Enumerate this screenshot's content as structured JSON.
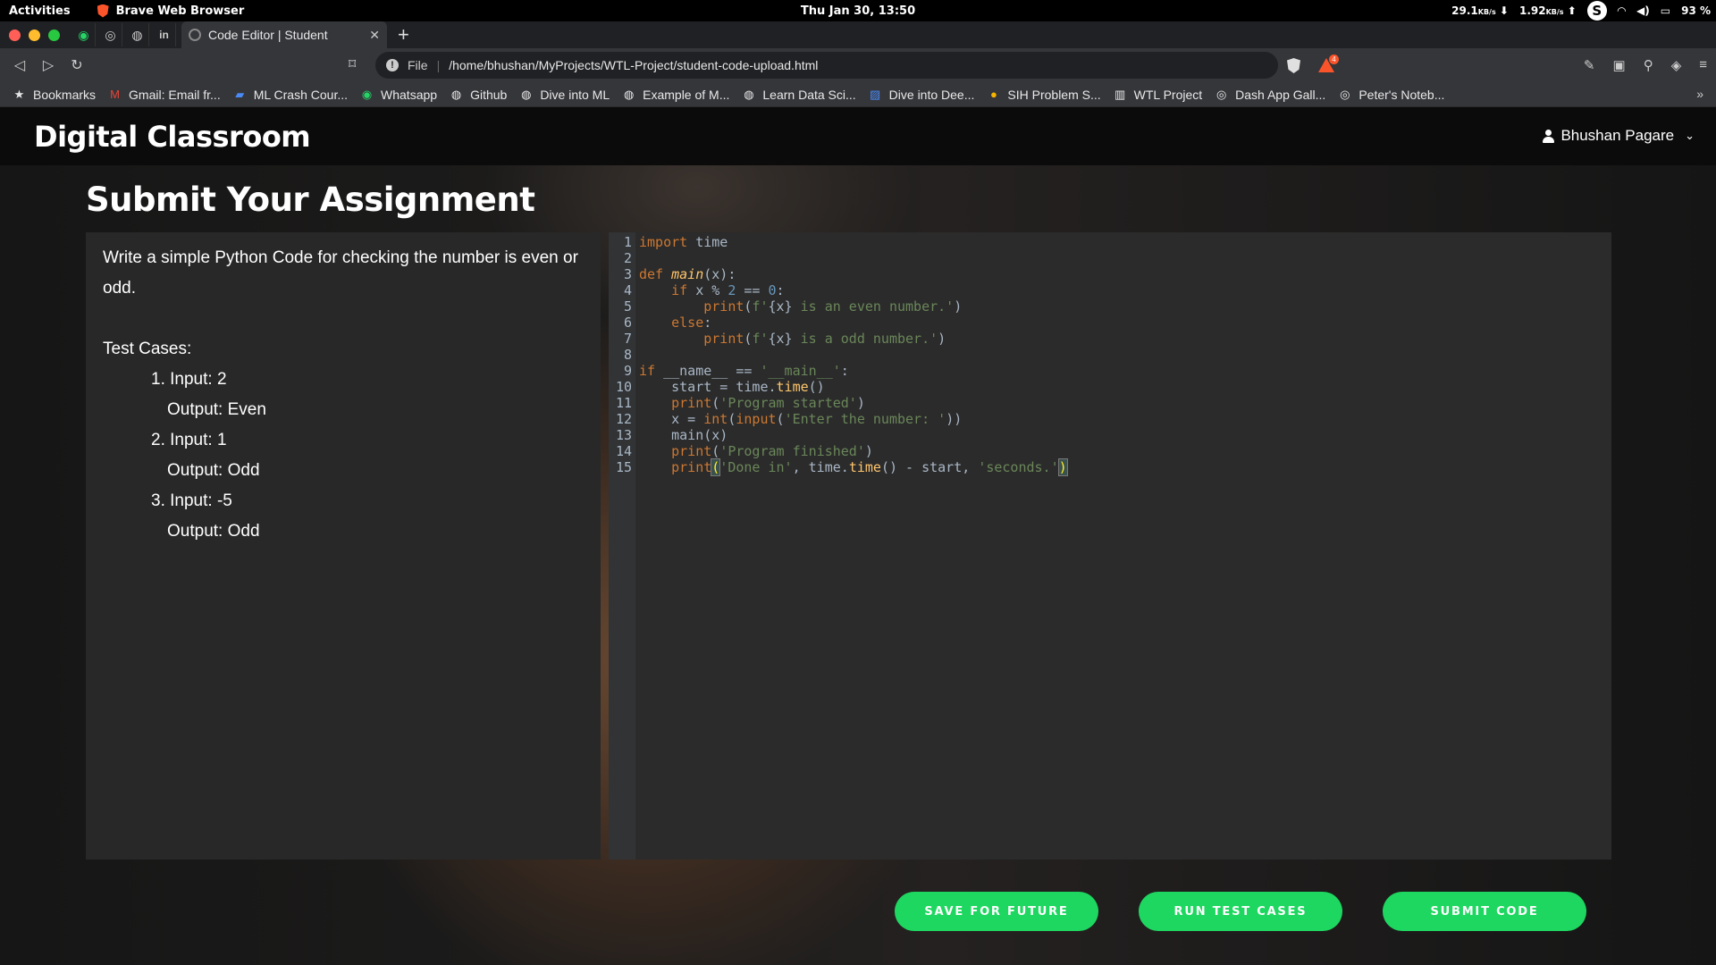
{
  "os": {
    "activities": "Activities",
    "app_name": "Brave Web Browser",
    "clock": "Thu Jan 30, 13:50",
    "down_rate": "29.1",
    "down_unit": "KB/s",
    "up_rate": "1.92",
    "up_unit": "KB/s",
    "skype_letter": "S",
    "battery": "93 %"
  },
  "browser": {
    "tab_title": "Code Editor | Student",
    "url_scheme": "File",
    "url_path": "/home/bhushan/MyProjects/WTL-Project/student-code-upload.html",
    "alert_count": "4",
    "bookmarks": [
      {
        "label": "Bookmarks",
        "icon": "star-icon"
      },
      {
        "label": "Gmail: Email fr...",
        "icon": "gmail-icon"
      },
      {
        "label": "ML Crash Cour...",
        "icon": "ml-icon"
      },
      {
        "label": "Whatsapp",
        "icon": "whatsapp-icon"
      },
      {
        "label": "Github",
        "icon": "github-icon"
      },
      {
        "label": "Dive into ML",
        "icon": "github-icon"
      },
      {
        "label": "Example of M...",
        "icon": "github-icon"
      },
      {
        "label": "Learn Data Sci...",
        "icon": "github-icon"
      },
      {
        "label": "Dive into Dee...",
        "icon": "book-icon"
      },
      {
        "label": "SIH Problem S...",
        "icon": "bulb-icon"
      },
      {
        "label": "WTL Project",
        "icon": "trello-icon"
      },
      {
        "label": "Dash App Gall...",
        "icon": "globe-icon"
      },
      {
        "label": "Peter's Noteb...",
        "icon": "globe-icon"
      }
    ]
  },
  "app": {
    "brand": "Digital Classroom",
    "user_name": "Bhushan Pagare",
    "heading": "Submit Your Assignment",
    "question_text": "Write a simple Python Code for checking the number is even or odd.",
    "test_cases_label": "Test Cases:",
    "test_cases": [
      {
        "input": "1. Input: 2",
        "output": "Output: Even"
      },
      {
        "input": "2. Input: 1",
        "output": "Output: Odd"
      },
      {
        "input": "3. Input: -5",
        "output": "Output: Odd"
      }
    ],
    "line_numbers": [
      "1",
      "2",
      "3",
      "4",
      "5",
      "6",
      "7",
      "8",
      "9",
      "10",
      "11",
      "12",
      "13",
      "14",
      "15"
    ],
    "buttons": {
      "save": "SAVE FOR FUTURE",
      "run": "RUN TEST CASES",
      "submit": "SUBMIT CODE"
    }
  },
  "colors": {
    "accent_green": "#1ed760",
    "navbar": "#0b0b0b",
    "editor_bg": "#2b2b2b"
  }
}
